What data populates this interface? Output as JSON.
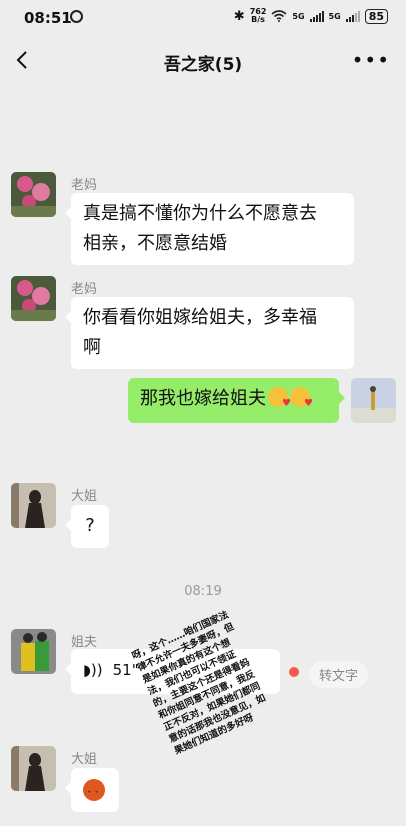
{
  "status_bar": {
    "time": "08:51",
    "speed_value": "762",
    "speed_unit": "B/s",
    "net_label_1": "5G",
    "net_label_2": "5G",
    "battery": "85"
  },
  "header": {
    "title": "吾之家(5)"
  },
  "messages": [
    {
      "sender": "老妈",
      "text_1": "真是搞不懂你为什么不愿意去",
      "text_2": "相亲，不愿意结婚"
    },
    {
      "sender": "老妈",
      "text_1": "你看看你姐嫁给姐夫，多幸福",
      "text_2": "啊"
    },
    {
      "sender": "me",
      "text": "那我也嫁给姐夫"
    },
    {
      "sender": "大姐",
      "text": "?"
    },
    {
      "time_divider": "08:19"
    },
    {
      "sender": "姐夫",
      "voice_duration": "51\"",
      "transcribe_label": "转文字"
    },
    {
      "sender": "大姐"
    }
  ],
  "handwritten_note": "呀，这个……咱们国家法律不允许一夫多妻呀，但是如果你真的有这个想法，我们也可以不领证的，主要这个还是得看妈和你姐同意不同意，我反正不反对，如果她们都同意的话那我也没意见，如果她们知道的多好呀",
  "colors": {
    "background": "#ededed",
    "my_bubble": "#95ec69",
    "other_bubble": "#ffffff",
    "unread_dot": "#f25a4a"
  }
}
